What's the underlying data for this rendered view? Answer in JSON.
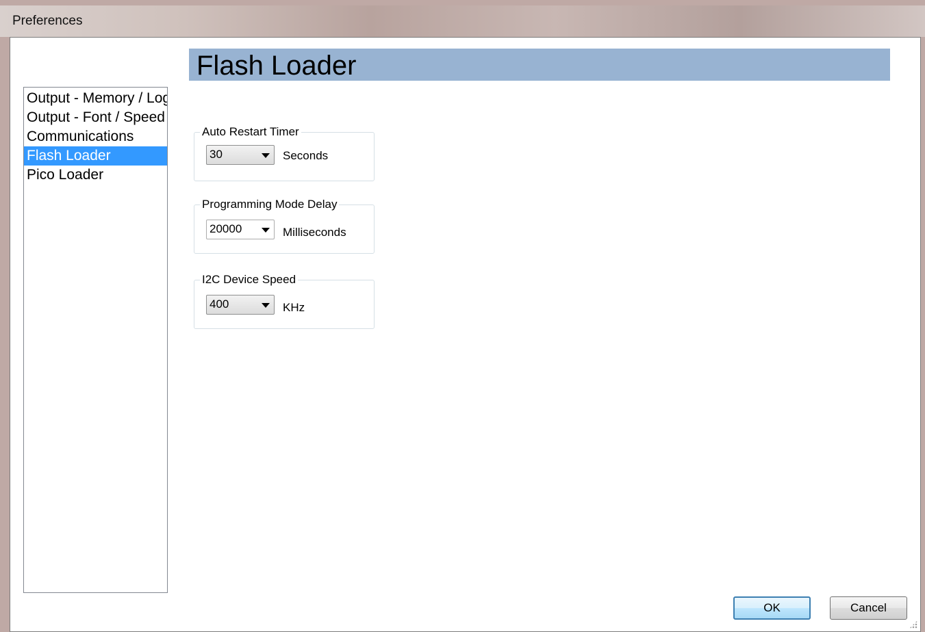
{
  "window": {
    "title": "Preferences"
  },
  "nav": {
    "items": [
      {
        "label": "Output - Memory / Log"
      },
      {
        "label": "Output - Font / Speed"
      },
      {
        "label": "Communications"
      },
      {
        "label": "Flash Loader",
        "selected": true
      },
      {
        "label": "Pico Loader"
      }
    ]
  },
  "header": {
    "title": "Flash Loader"
  },
  "groups": {
    "auto_restart": {
      "legend": "Auto Restart Timer",
      "value": "30",
      "unit": "Seconds"
    },
    "programming_delay": {
      "legend": "Programming Mode Delay",
      "value": "20000",
      "unit": "Milliseconds"
    },
    "i2c_speed": {
      "legend": "I2C Device Speed",
      "value": "400",
      "unit": "KHz"
    }
  },
  "buttons": {
    "ok": "OK",
    "cancel": "Cancel"
  },
  "colors": {
    "header_bg": "#98b3d2",
    "selection": "#3399ff"
  }
}
